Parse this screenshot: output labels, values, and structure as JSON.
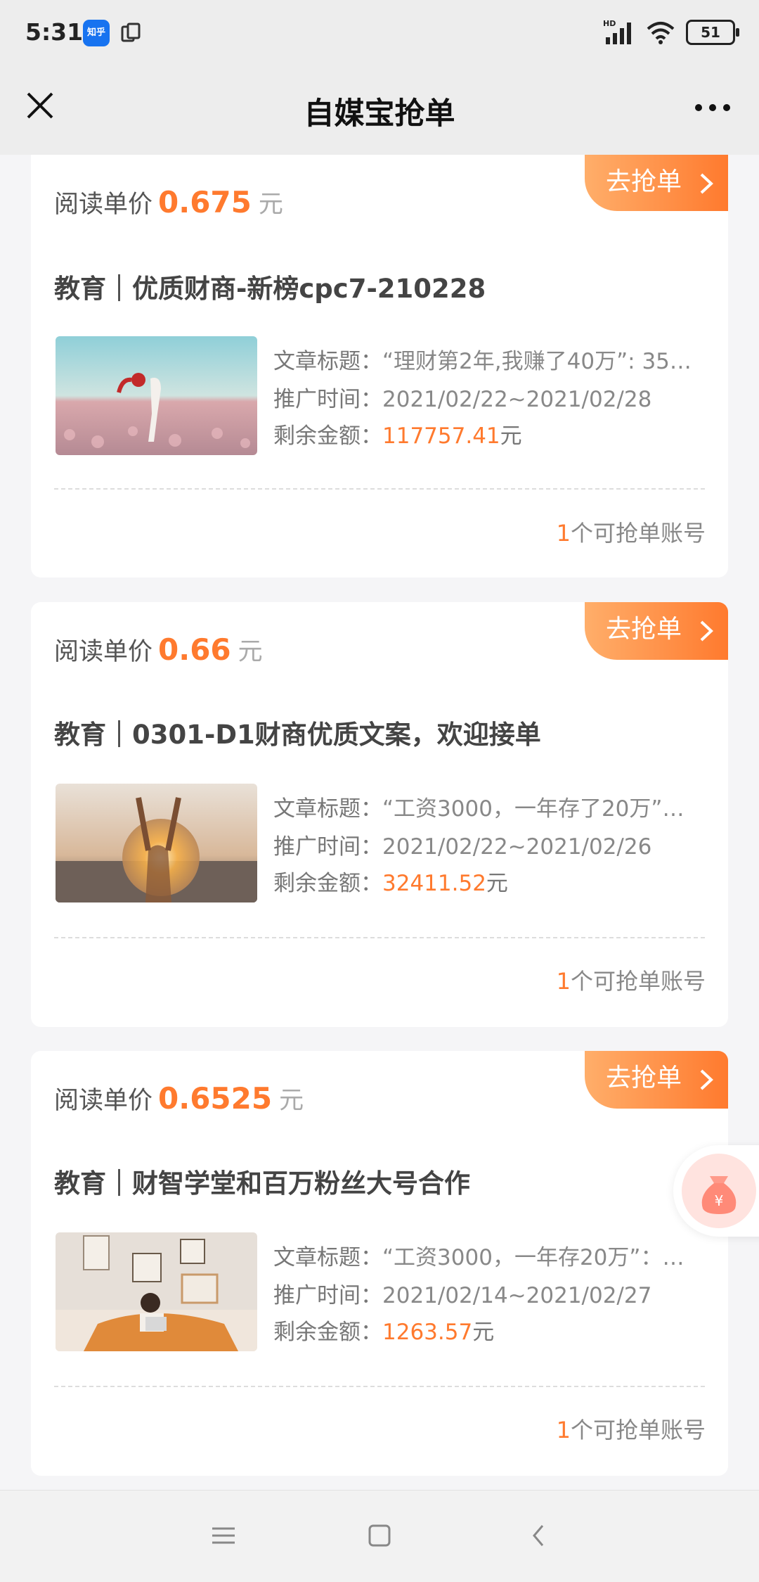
{
  "status_bar": {
    "time": "5:31",
    "battery": "51",
    "network": "HD"
  },
  "header": {
    "title": "自媒宝抢单"
  },
  "cards": [
    {
      "grab_label": "去抢单",
      "price_label": "阅读单价",
      "price": "0.675",
      "price_unit": "元",
      "title": "教育｜优质财商-新榜cpc7-210228",
      "article_label": "文章标题：",
      "article_title": "“理财第2年,我赚了40万”: 35…",
      "period_label": "推广时间：",
      "period": "2021/02/22~2021/02/28",
      "balance_label": "剩余金额：",
      "balance": "117757.41",
      "balance_unit": "元",
      "accounts_count": "1",
      "accounts_text": "个可抢单账号"
    },
    {
      "grab_label": "去抢单",
      "price_label": "阅读单价",
      "price": "0.66",
      "price_unit": "元",
      "title": "教育｜0301-D1财商优质文案，欢迎接单",
      "article_label": "文章标题：",
      "article_title": "“工资3000，一年存了20万”…",
      "period_label": "推广时间：",
      "period": "2021/02/22~2021/02/26",
      "balance_label": "剩余金额：",
      "balance": "32411.52",
      "balance_unit": "元",
      "accounts_count": "1",
      "accounts_text": "个可抢单账号"
    },
    {
      "grab_label": "去抢单",
      "price_label": "阅读单价",
      "price": "0.6525",
      "price_unit": "元",
      "title": "教育｜财智学堂和百万粉丝大号合作",
      "article_label": "文章标题：",
      "article_title": "“工资3000，一年存20万”：…",
      "period_label": "推广时间：",
      "period": "2021/02/14~2021/02/27",
      "balance_label": "剩余金额：",
      "balance": "1263.57",
      "balance_unit": "元",
      "accounts_count": "1",
      "accounts_text": "个可抢单账号"
    }
  ],
  "colors": {
    "accent": "#ff7a2e",
    "background": "#f5f5f7",
    "header": "#ededed"
  }
}
